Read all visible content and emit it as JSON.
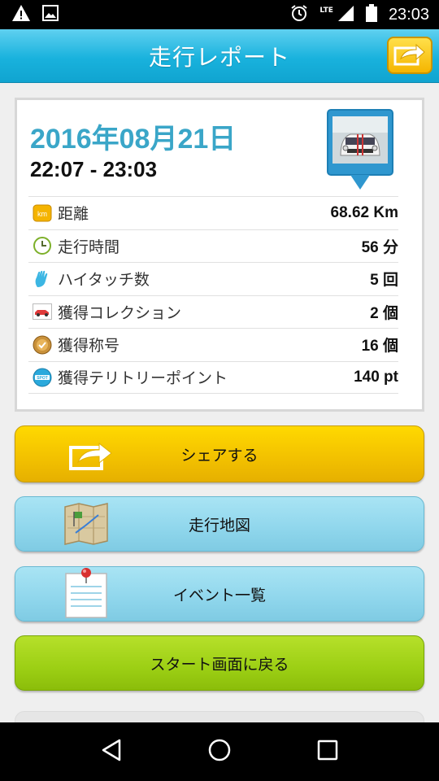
{
  "status_bar": {
    "time": "23:03",
    "network_label": "LTE",
    "icons": [
      "warning-icon",
      "image-icon",
      "alarm-icon",
      "signal-icon",
      "battery-icon"
    ]
  },
  "header": {
    "title": "走行レポート",
    "share_icon": "share-icon"
  },
  "report": {
    "date": "2016年08月21日",
    "time_range": "22:07 - 23:03",
    "stats": [
      {
        "icon": "km-icon",
        "label": "距離",
        "value": "68.62 Km"
      },
      {
        "icon": "clock-icon",
        "label": "走行時間",
        "value": "56 分"
      },
      {
        "icon": "high-five-icon",
        "label": "ハイタッチ数",
        "value": "5 回"
      },
      {
        "icon": "car-collection-icon",
        "label": "獲得コレクション",
        "value": "2 個"
      },
      {
        "icon": "title-medal-icon",
        "label": "獲得称号",
        "value": "16 個"
      },
      {
        "icon": "spot-icon",
        "label": "獲得テリトリーポイント",
        "value": "140 pt"
      }
    ],
    "km_badge": "km",
    "spot_badge": "SPOT"
  },
  "buttons": {
    "share": "シェアする",
    "map": "走行地図",
    "events": "イベント一覧",
    "start": "スタート画面に戻る"
  },
  "colors": {
    "header": "#19b2dd",
    "date_text": "#3aa6c8",
    "share_button": "#f2c000",
    "blue_button": "#8fd6ec",
    "green_button": "#9ccf14"
  }
}
